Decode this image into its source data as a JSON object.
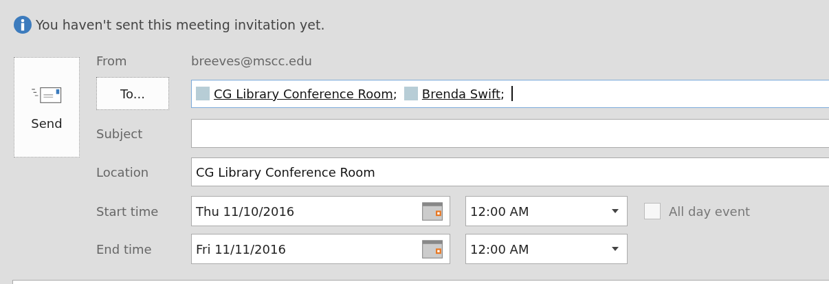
{
  "info_bar": {
    "message": "You haven't sent this meeting invitation yet."
  },
  "send_button": {
    "label": "Send"
  },
  "from": {
    "label": "From",
    "value": "breeves@mscc.edu"
  },
  "to": {
    "button": "To...",
    "focused": true,
    "recipients": [
      {
        "name": "CG Library Conference Room",
        "separator": ";",
        "color": "#b7cdd6"
      },
      {
        "name": "Brenda Swift",
        "separator": ";",
        "color": "#b7cdd6"
      }
    ]
  },
  "subject": {
    "label": "Subject"
  },
  "location": {
    "label": "Location",
    "value": "CG Library Conference Room"
  },
  "times": [
    {
      "label": "Start time",
      "date": "Thu 11/10/2016",
      "time": "12:00 AM"
    },
    {
      "label": "End time",
      "date": "Fri 11/11/2016",
      "time": "12:00 AM"
    }
  ],
  "all_day": {
    "label": "All day event",
    "checked": false
  }
}
